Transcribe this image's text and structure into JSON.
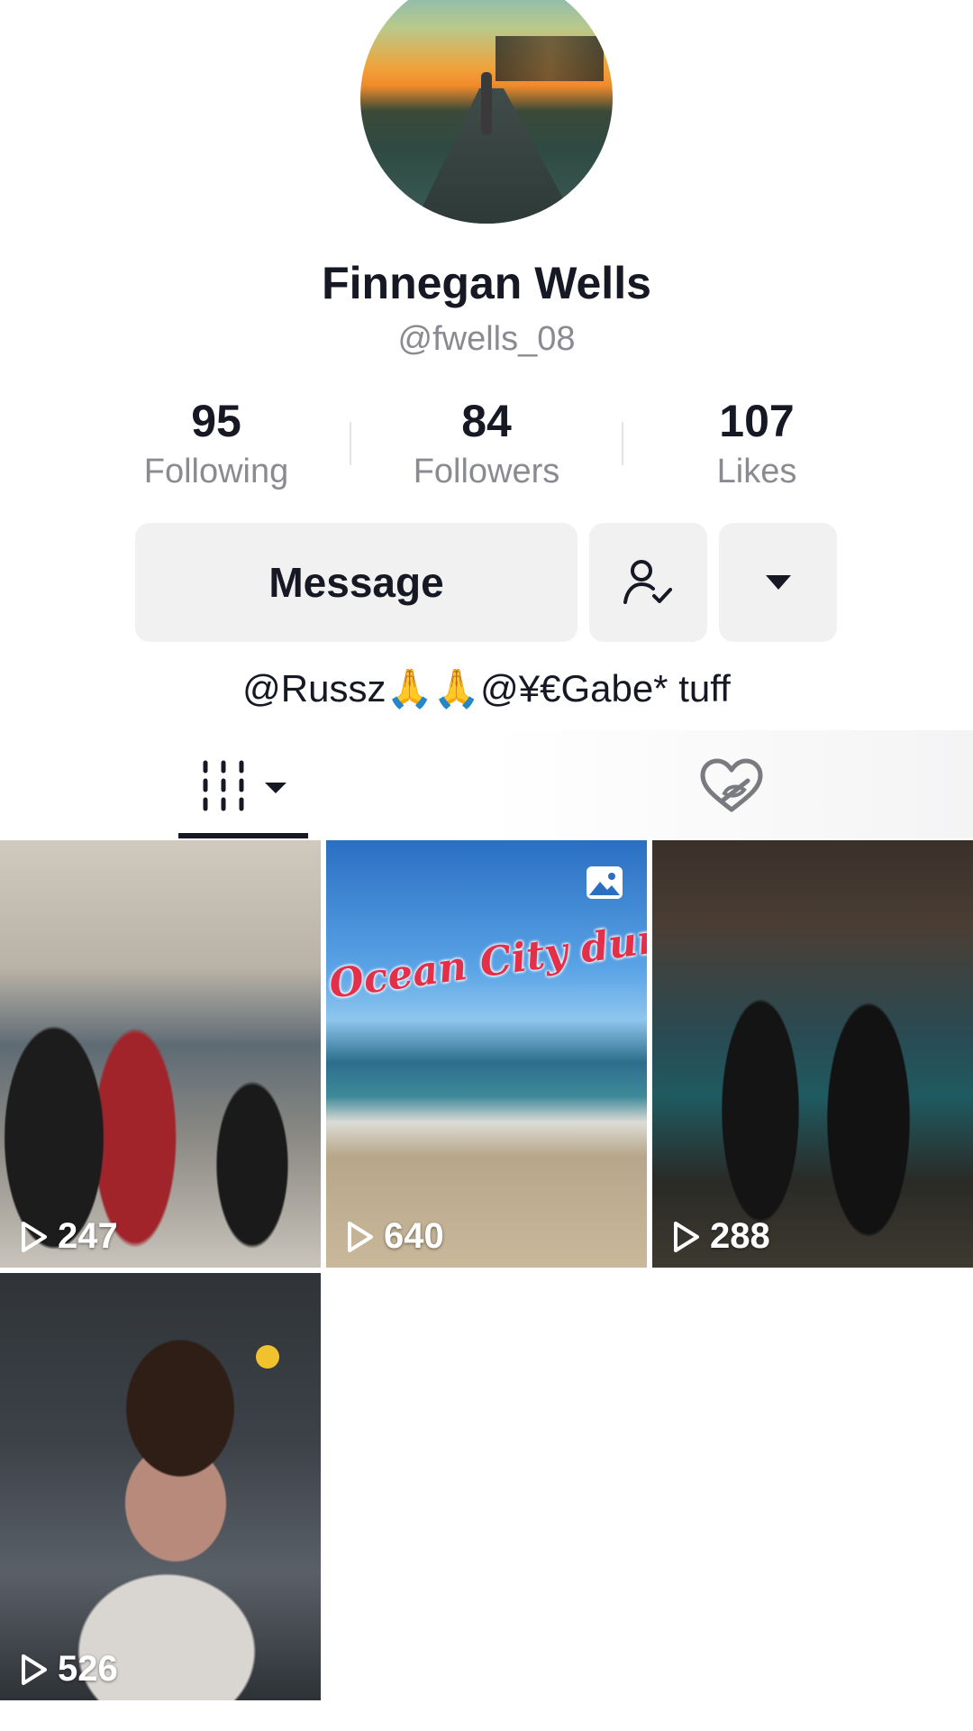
{
  "profile": {
    "display_name": "Finnegan Wells",
    "username": "@fwells_08",
    "bio": "@Russz🙏🙏@¥€Gabe* tuff"
  },
  "stats": [
    {
      "value": "95",
      "label": "Following"
    },
    {
      "value": "84",
      "label": "Followers"
    },
    {
      "value": "107",
      "label": "Likes"
    }
  ],
  "actions": {
    "message_label": "Message",
    "follow_icon": "user-check-icon",
    "more_icon": "caret-down-icon"
  },
  "tabs": {
    "videos_icon": "grid-icon",
    "liked_icon": "hidden-heart-icon",
    "active": "videos"
  },
  "videos": [
    {
      "views": "247",
      "type": "video"
    },
    {
      "views": "640",
      "type": "photo",
      "overlay_text": "Ocean City dump"
    },
    {
      "views": "288",
      "type": "video"
    },
    {
      "views": "526",
      "type": "video"
    }
  ],
  "colors": {
    "text_primary": "#161823",
    "text_secondary": "#8a8b91",
    "button_bg": "#f1f1f2",
    "overlay_red": "#e3304a"
  }
}
